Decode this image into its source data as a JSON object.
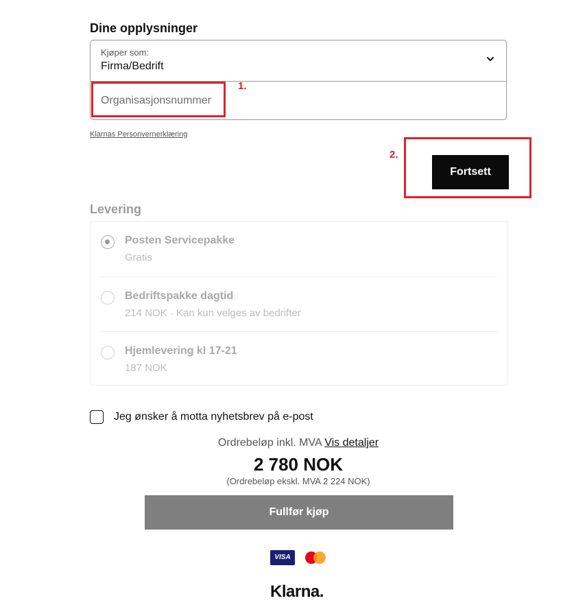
{
  "personal_info": {
    "title": "Dine opplysninger",
    "buyer_type_label": "Kjøper som:",
    "buyer_type_value": "Firma/Bedrift",
    "org_number_placeholder": "Organisasjonsnummer",
    "privacy_link": "Klarnas Personvernerklæring"
  },
  "annotations": {
    "first_label": "1.",
    "second_label": "2.",
    "color": "#e0202a"
  },
  "continue_button": "Fortsett",
  "delivery": {
    "title": "Levering",
    "options": [
      {
        "name": "Posten Servicepakke",
        "detail": "Gratis",
        "selected": true
      },
      {
        "name": "Bedriftspakke dagtid",
        "detail": "214 NOK · Kan kun velges av bedrifter",
        "selected": false
      },
      {
        "name": "Hjemlevering kl 17-21",
        "detail": "187 NOK",
        "selected": false
      }
    ]
  },
  "newsletter": {
    "label": "Jeg ønsker å motta nyhetsbrev på e-post",
    "checked": false
  },
  "order": {
    "amount_label": "Ordrebeløp inkl. MVA",
    "details_link": "Vis detaljer",
    "total": "2 780 NOK",
    "total_ex_vat": "(Ordrebeløp ekskl. MVA 2 224 NOK)",
    "complete_button": "Fullfør kjøp"
  },
  "payment_badges": {
    "visa": "VISA",
    "mastercard_icon": "mastercard-icon"
  },
  "branding": {
    "logo": "Klarna."
  },
  "colors": {
    "primary_button": "#0b0b0b",
    "disabled_button": "#7f7f7f",
    "annotation": "#e0202a"
  }
}
